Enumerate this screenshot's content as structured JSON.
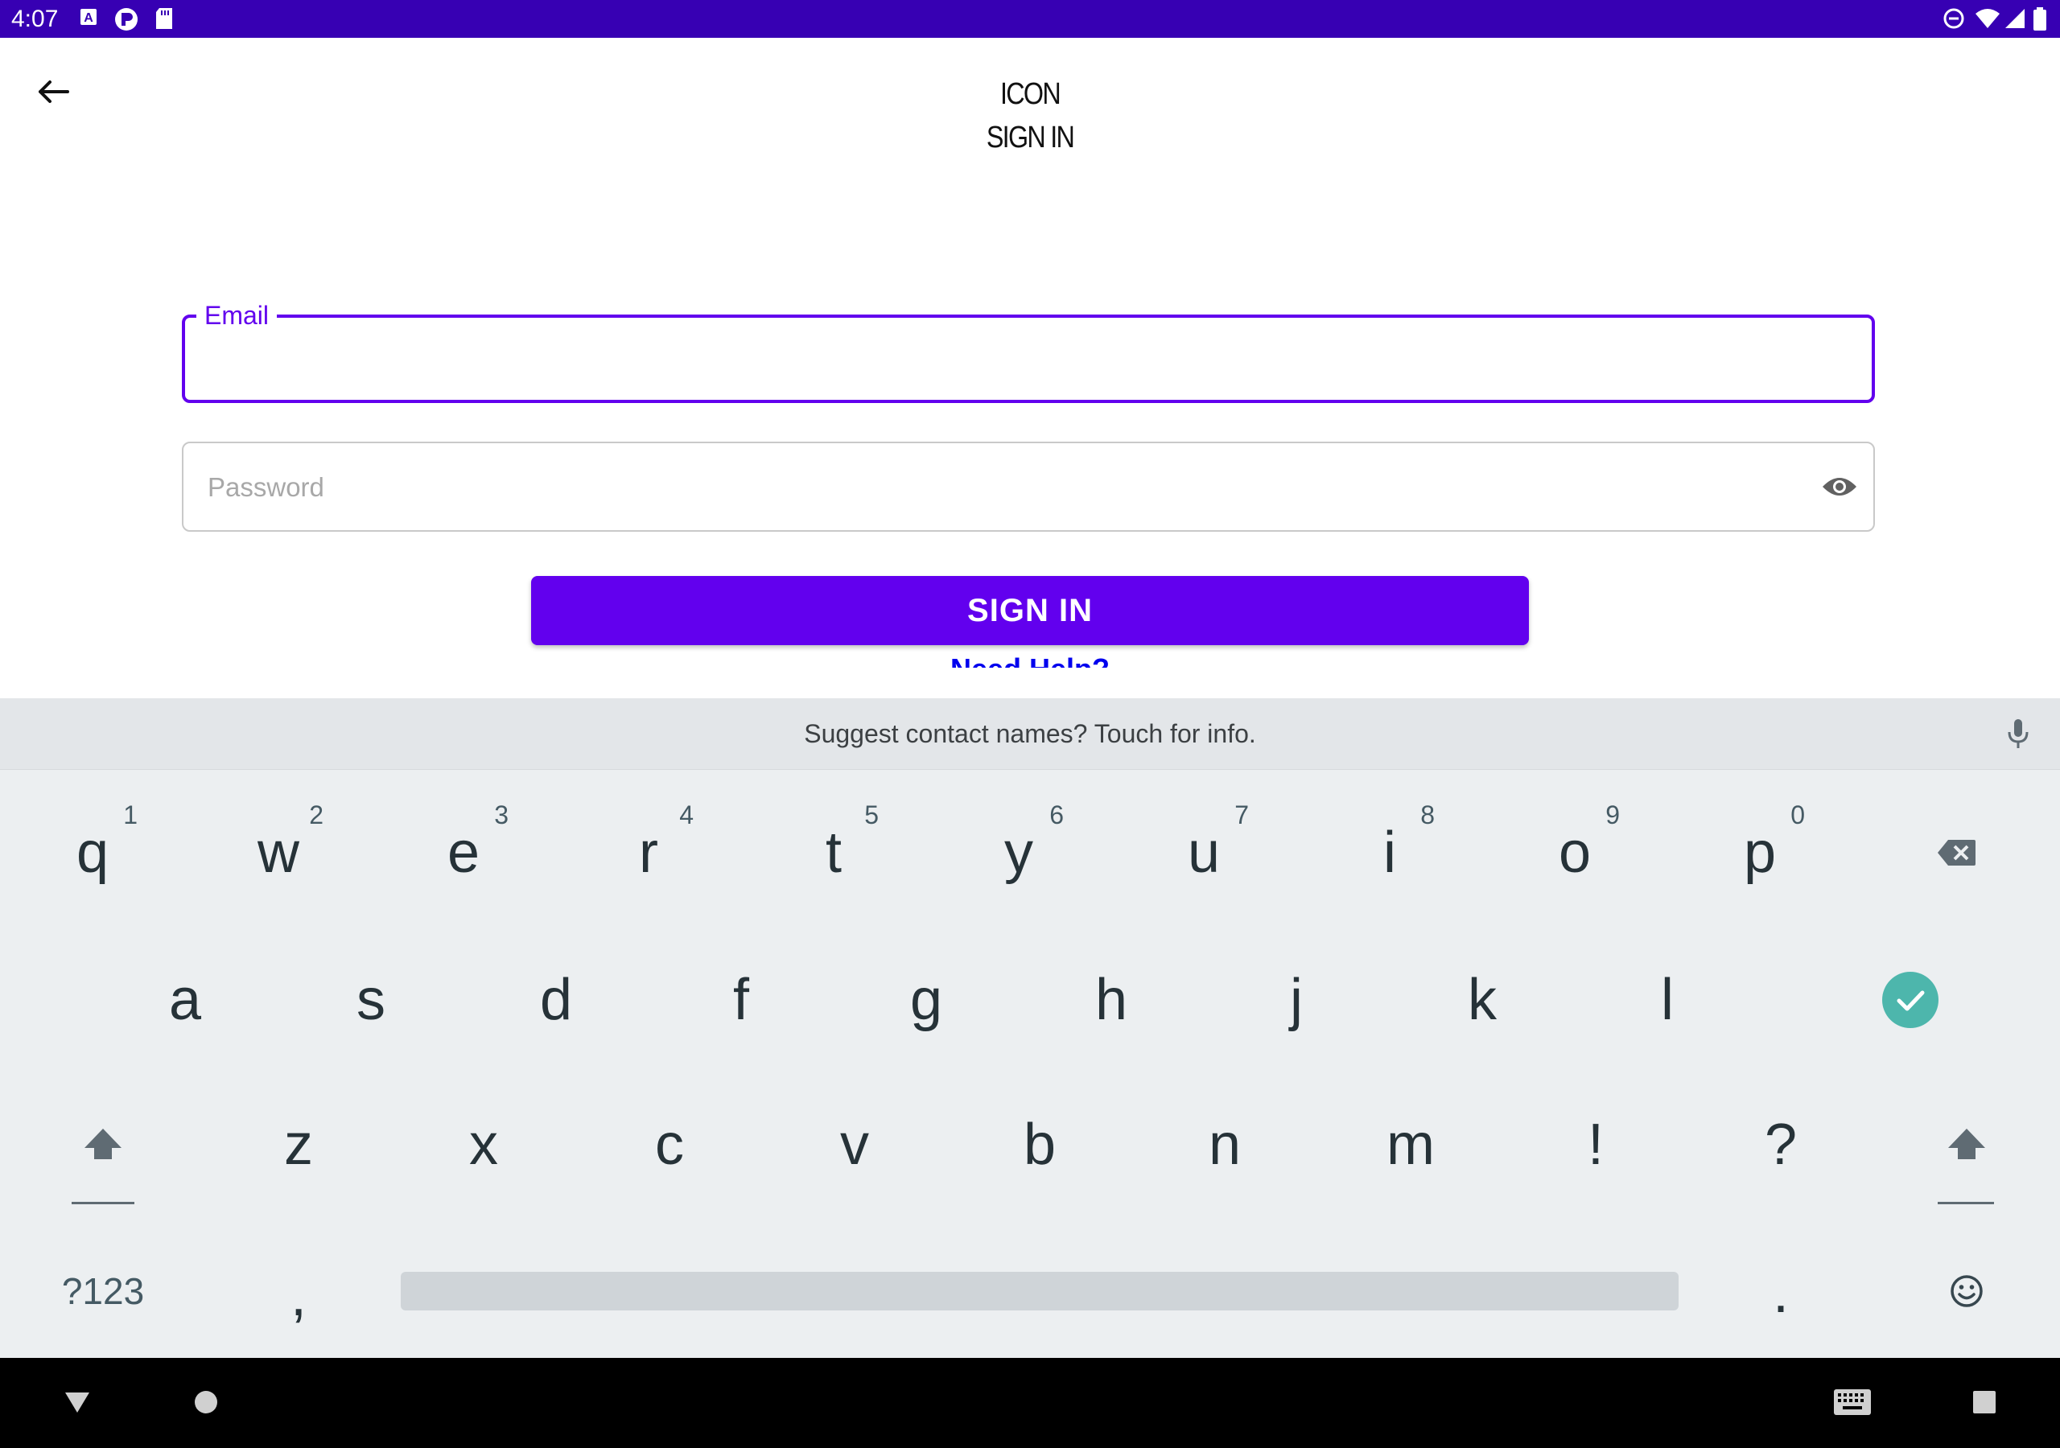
{
  "status_bar": {
    "time": "4:07",
    "left_icons": [
      "a-icon",
      "p-icon",
      "sd-card-icon"
    ],
    "right_icons": [
      "dnd-icon",
      "wifi-icon",
      "signal-icon",
      "battery-icon"
    ],
    "color": "#3700B3"
  },
  "header": {
    "title_line1": "ICON",
    "title_line2": "SIGN IN"
  },
  "form": {
    "email_label": "Email",
    "password_placeholder": "Password",
    "signin_label": "SIGN IN",
    "help_link": "Need Help?",
    "accent": "#6200EE"
  },
  "keyboard": {
    "suggestion": "Suggest contact names? Touch for info.",
    "row1": [
      {
        "key": "q",
        "hint": "1"
      },
      {
        "key": "w",
        "hint": "2"
      },
      {
        "key": "e",
        "hint": "3"
      },
      {
        "key": "r",
        "hint": "4"
      },
      {
        "key": "t",
        "hint": "5"
      },
      {
        "key": "y",
        "hint": "6"
      },
      {
        "key": "u",
        "hint": "7"
      },
      {
        "key": "i",
        "hint": "8"
      },
      {
        "key": "o",
        "hint": "9"
      },
      {
        "key": "p",
        "hint": "0"
      }
    ],
    "row2": [
      "a",
      "s",
      "d",
      "f",
      "g",
      "h",
      "j",
      "k",
      "l"
    ],
    "row3": [
      "z",
      "x",
      "c",
      "v",
      "b",
      "n",
      "m",
      "!",
      "?"
    ],
    "symbols_label": "?123",
    "comma": ",",
    "period": ".",
    "action_color": "#4DB6AC"
  }
}
